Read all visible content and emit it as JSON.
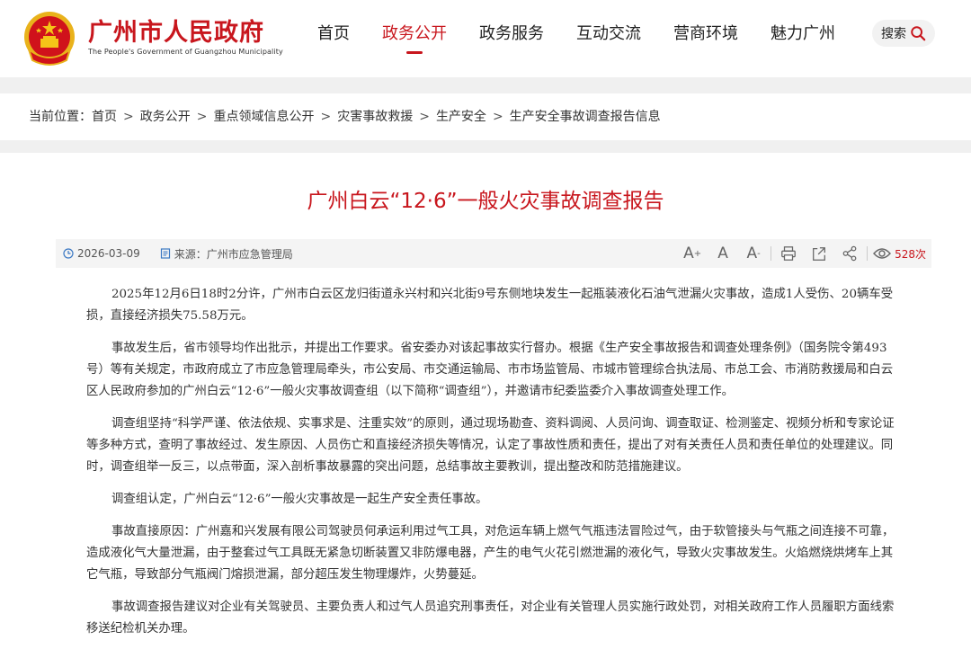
{
  "header": {
    "site_name": "广州市人民政府",
    "site_name_en": "The People's Government of Guangzhou Municipality",
    "nav": [
      {
        "label": "首页",
        "active": false
      },
      {
        "label": "政务公开",
        "active": true
      },
      {
        "label": "政务服务",
        "active": false
      },
      {
        "label": "互动交流",
        "active": false
      },
      {
        "label": "营商环境",
        "active": false
      },
      {
        "label": "魅力广州",
        "active": false
      }
    ],
    "search_label": "搜索"
  },
  "breadcrumb": {
    "prefix": "当前位置：",
    "items": [
      "首页",
      "政务公开",
      "重点领域信息公开",
      "灾害事故救援",
      "生产安全",
      "生产安全事故调查报告信息"
    ],
    "separator": ">"
  },
  "article": {
    "title": "广州白云“12·6”一般火灾事故调查报告",
    "date": "2026-03-09",
    "source": "来源：广州市应急管理局",
    "views": "528次",
    "tools": [
      "font-increase-icon",
      "font-reset-icon",
      "font-decrease-icon",
      "print-icon",
      "share-out-icon",
      "share-icon",
      "eye-icon"
    ],
    "paragraphs": [
      "2025年12月6日18时2分许，广州市白云区龙归街道永兴村和兴北街9号东侧地块发生一起瓶装液化石油气泄漏火灾事故，造成1人受伤、20辆车受损，直接经济损失75.58万元。",
      "事故发生后，省市领导均作出批示，并提出工作要求。省安委办对该起事故实行督办。根据《生产安全事故报告和调查处理条例》（国务院令第493号）等有关规定，市政府成立了市应急管理局牵头，市公安局、市交通运输局、市市场监管局、市城市管理综合执法局、市总工会、市消防救援局和白云区人民政府参加的广州白云“12·6”一般火灾事故调查组（以下简称“调查组”），并邀请市纪委监委介入事故调查处理工作。",
      "调查组坚持“科学严谨、依法依规、实事求是、注重实效”的原则，通过现场勘查、资料调阅、人员问询、调查取证、检测鉴定、视频分析和专家论证等多种方式，查明了事故经过、发生原因、人员伤亡和直接经济损失等情况，认定了事故性质和责任，提出了对有关责任人员和责任单位的处理建议。同时，调查组举一反三，以点带面，深入剖析事故暴露的突出问题，总结事故主要教训，提出整改和防范措施建议。",
      "调查组认定，广州白云“12·6”一般火灾事故是一起生产安全责任事故。",
      "事故直接原因：广州嘉和兴发展有限公司驾驶员何承运利用过气工具，对危运车辆上燃气气瓶违法冒险过气，由于软管接头与气瓶之间连接不可靠，造成液化气大量泄漏，由于整套过气工具既无紧急切断装置又非防爆电器，产生的电气火花引燃泄漏的液化气，导致火灾事故发生。火焰燃烧烘烤车上其它气瓶，导致部分气瓶阀门熔损泄漏，部分超压发生物理爆炸，火势蔓延。",
      "事故调查报告建议对企业有关驾驶员、主要负责人和过气人员追究刑事责任，对企业有关管理人员实施行政处罚，对相关政府工作人员履职方面线索移送纪检机关办理。"
    ]
  },
  "colors": {
    "brand_red": "#c8161d",
    "page_bg": "#f0f0f0"
  }
}
